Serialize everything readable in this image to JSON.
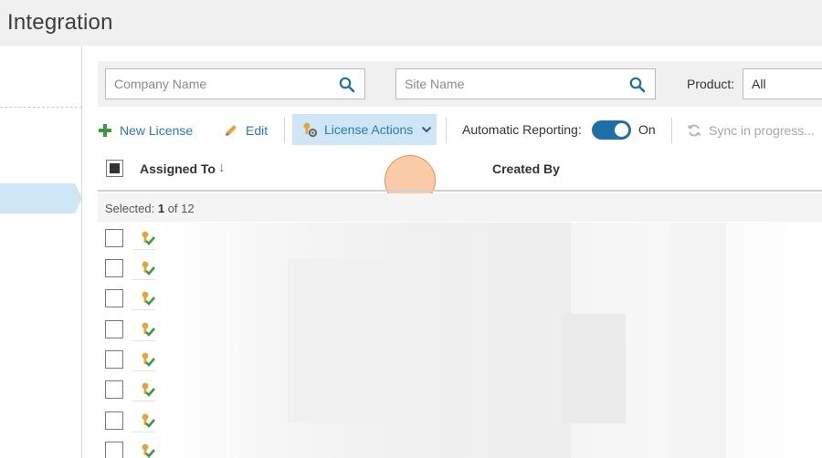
{
  "window": {
    "title": "Integration"
  },
  "filters": {
    "company_placeholder": "Company Name",
    "site_placeholder": "Site Name",
    "product_label": "Product:",
    "product_value": "All"
  },
  "toolbar": {
    "new_license": "New License",
    "edit": "Edit",
    "license_actions": "License Actions",
    "auto_reporting_label": "Automatic Reporting:",
    "auto_reporting_state": "On",
    "sync": "Sync in progress..."
  },
  "table": {
    "columns": {
      "assigned_to": "Assigned To",
      "created_by": "Created By"
    },
    "sort_indicator": "↓",
    "selection": {
      "prefix": "Selected:",
      "count": "1",
      "suffix": "of 12"
    },
    "rows": [
      {
        "checked": false,
        "icon": "license-icon"
      },
      {
        "checked": false,
        "icon": "license-icon"
      },
      {
        "checked": false,
        "icon": "license-icon"
      },
      {
        "checked": false,
        "icon": "license-icon"
      },
      {
        "checked": false,
        "icon": "license-icon"
      },
      {
        "checked": false,
        "icon": "license-icon"
      },
      {
        "checked": false,
        "icon": "license-icon"
      },
      {
        "checked": false,
        "icon": "license-icon"
      }
    ]
  },
  "colors": {
    "accent": "#2a7ab0",
    "toggle_on": "#1f6ea8",
    "selected_highlight": "#cfe6f7",
    "click_indicator": "#f6a05e"
  }
}
